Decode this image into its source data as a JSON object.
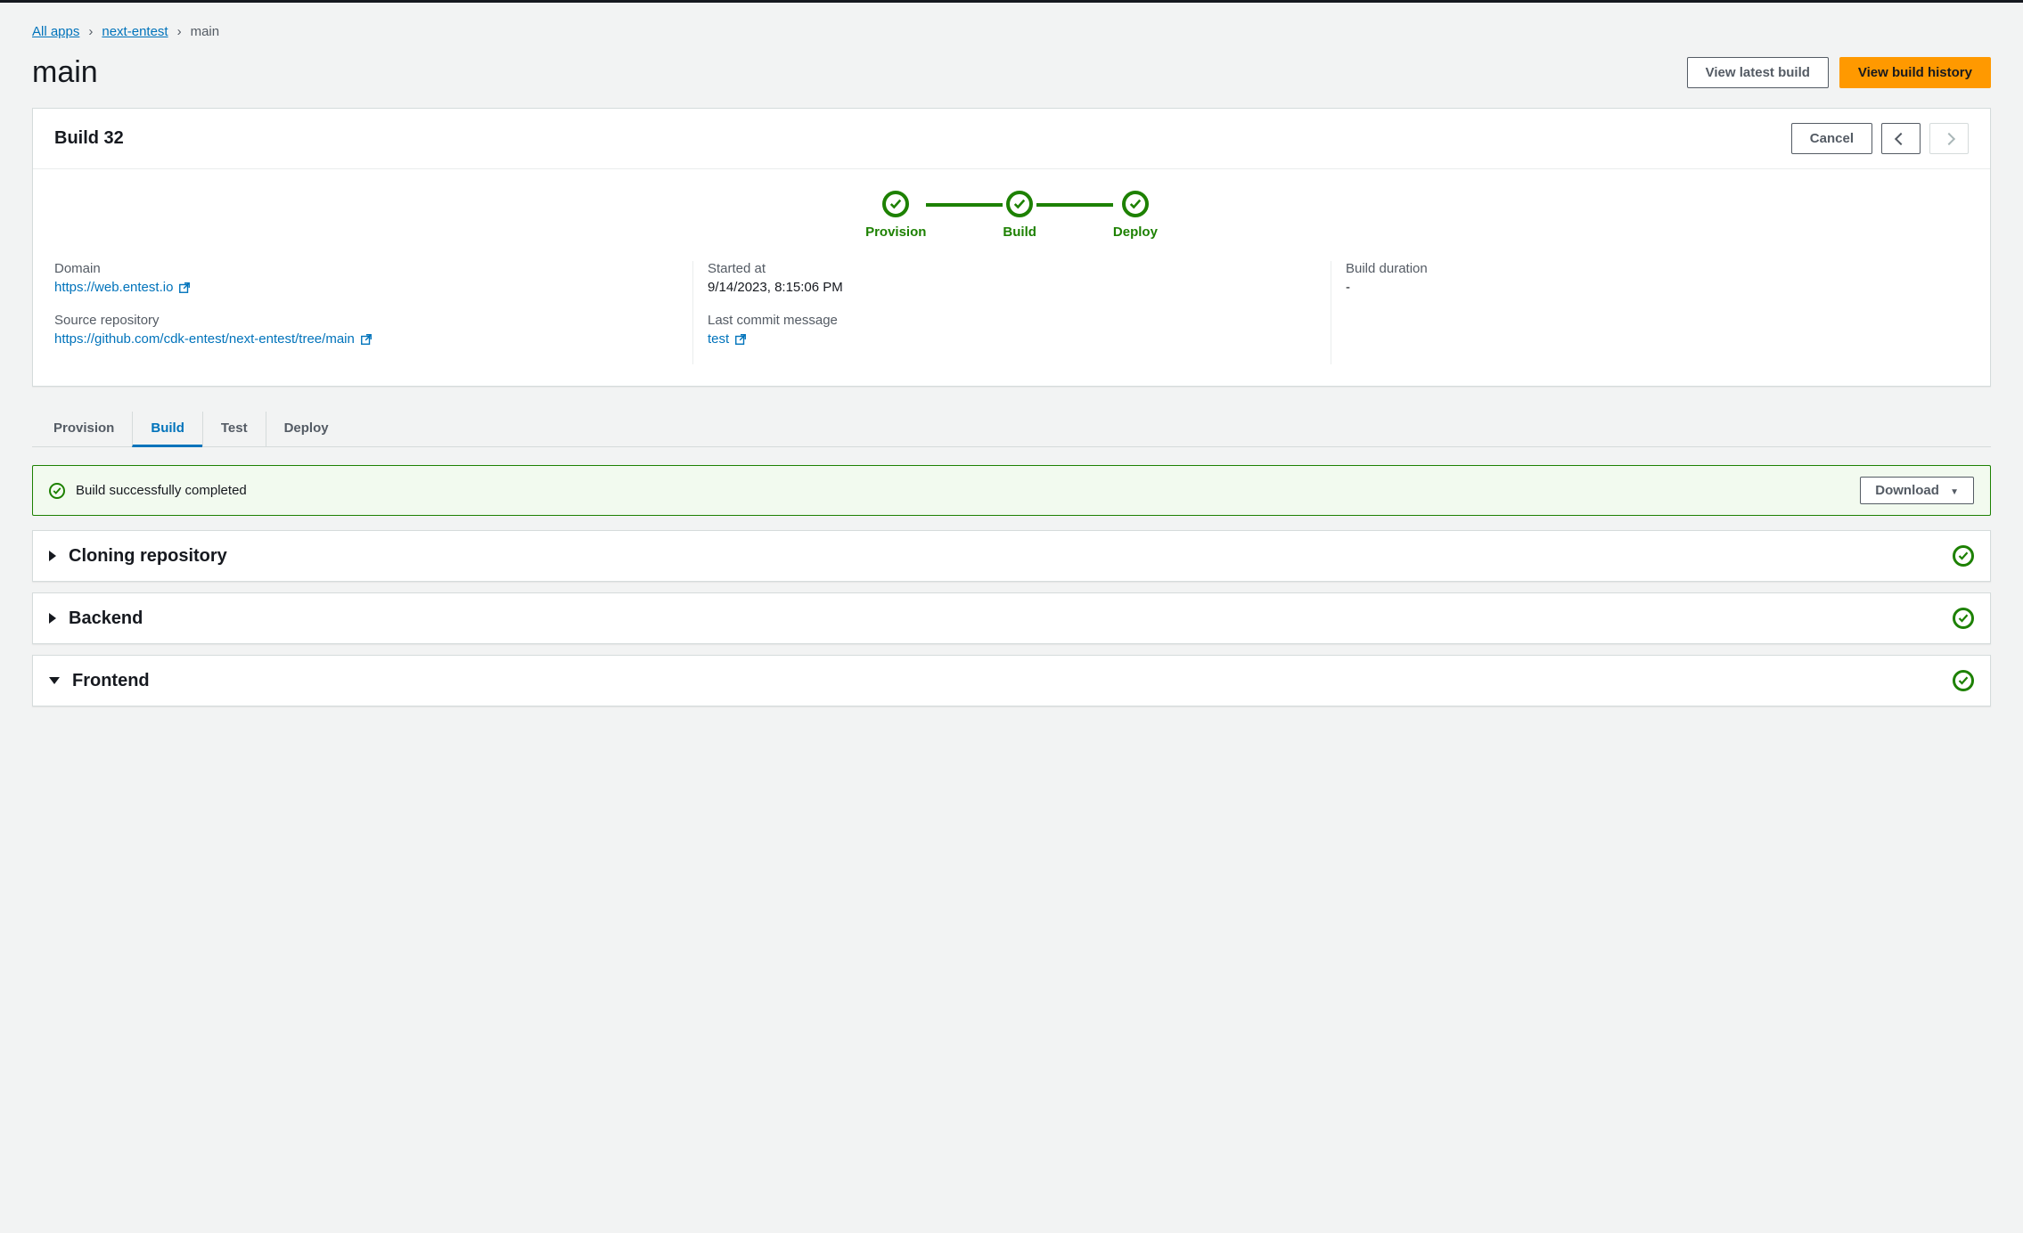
{
  "breadcrumb": {
    "all_apps": "All apps",
    "app": "next-entest",
    "current": "main"
  },
  "page_title": "main",
  "buttons": {
    "view_latest": "View latest build",
    "view_history": "View build history",
    "cancel": "Cancel",
    "download": "Download"
  },
  "build_card": {
    "title": "Build 32",
    "pipeline": {
      "provision": "Provision",
      "build": "Build",
      "deploy": "Deploy"
    },
    "fields": {
      "domain_label": "Domain",
      "domain_url": "https://web.entest.io",
      "repo_label": "Source repository",
      "repo_url": "https://github.com/cdk-entest/next-entest/tree/main",
      "started_label": "Started at",
      "started_value": "9/14/2023, 8:15:06 PM",
      "commit_label": "Last commit message",
      "commit_value": "test",
      "duration_label": "Build duration",
      "duration_value": "-"
    }
  },
  "tabs": {
    "provision": "Provision",
    "build": "Build",
    "test": "Test",
    "deploy": "Deploy"
  },
  "alert": {
    "message": "Build successfully completed"
  },
  "sections": {
    "cloning": "Cloning repository",
    "backend": "Backend",
    "frontend": "Frontend"
  }
}
